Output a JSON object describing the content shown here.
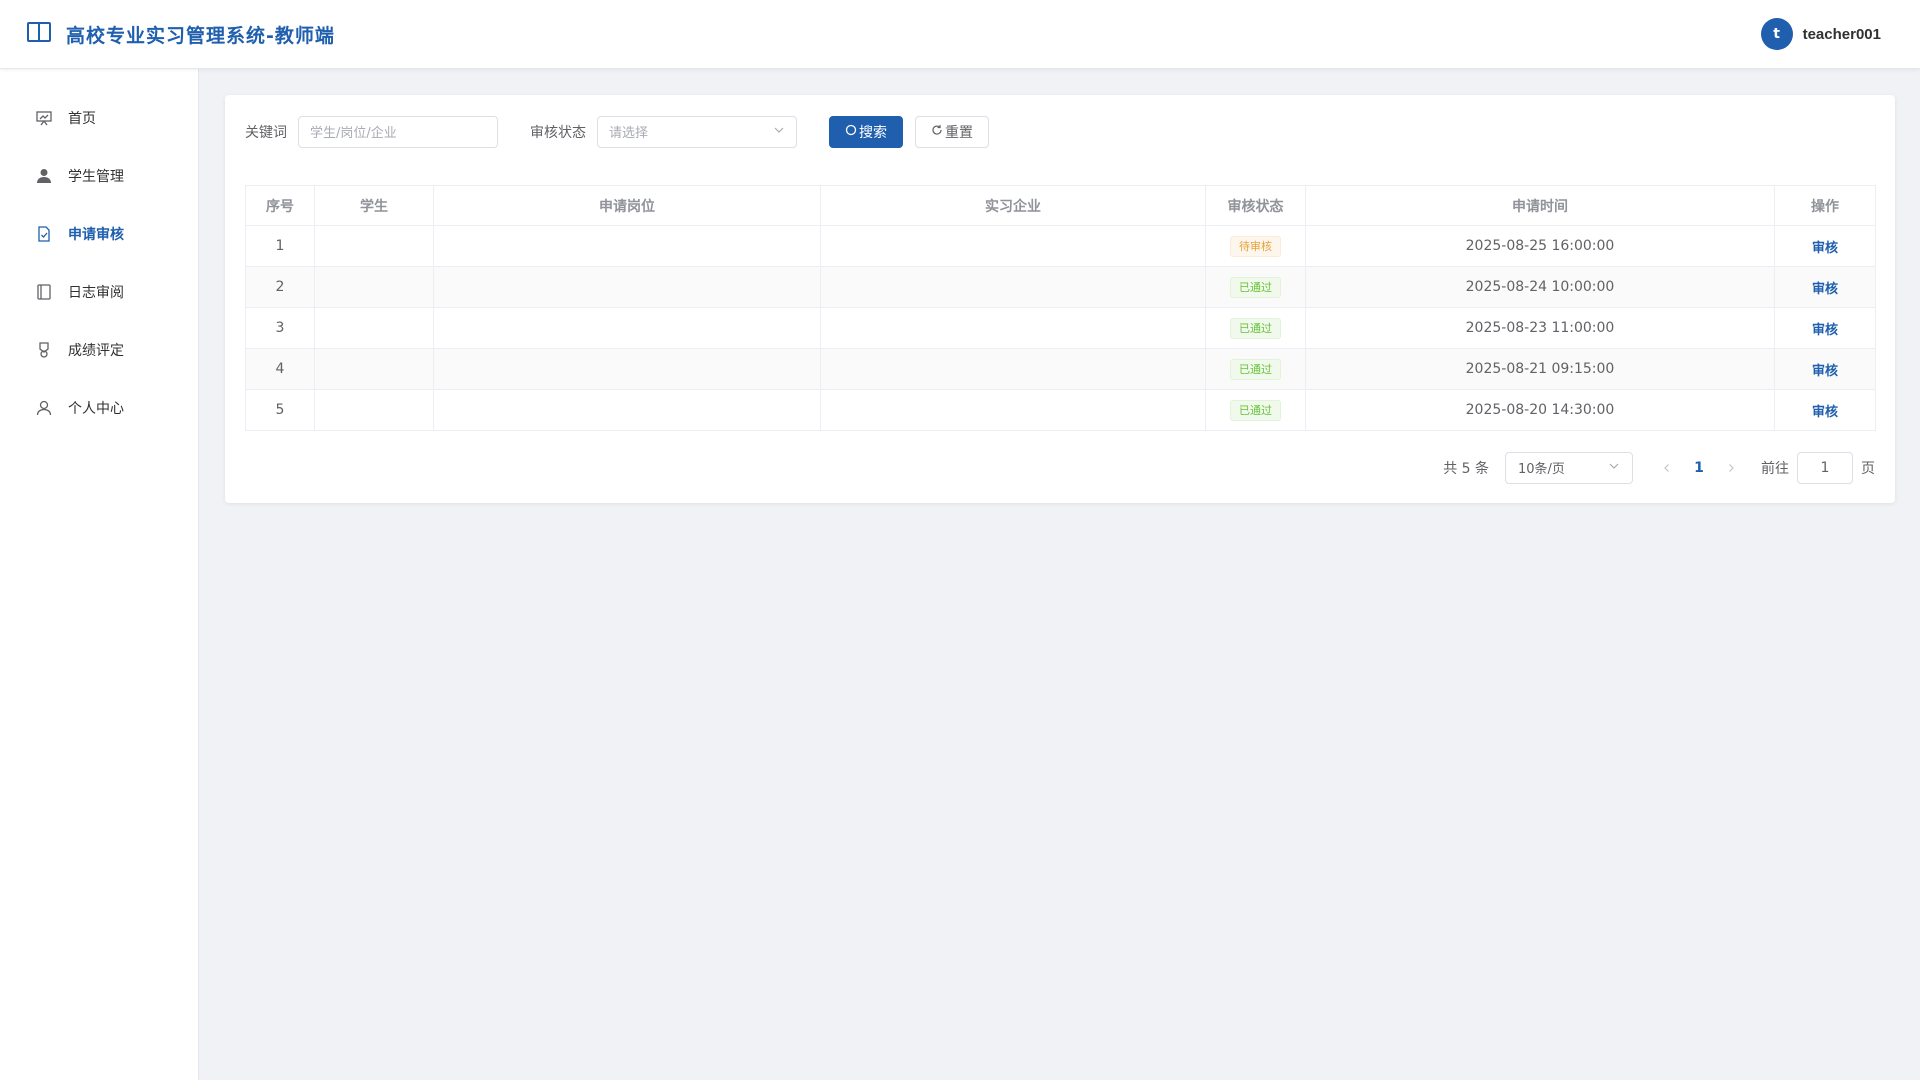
{
  "header": {
    "title": "高校专业实习管理系统-教师端",
    "icon": "book-open-icon",
    "avatar_letter": "t",
    "username": "teacher001"
  },
  "sidebar": {
    "items": [
      {
        "label": "首页",
        "icon": "presentation-board-icon",
        "active": false
      },
      {
        "label": "学生管理",
        "icon": "user-icon",
        "active": false
      },
      {
        "label": "申请审核",
        "icon": "document-check-icon",
        "active": true
      },
      {
        "label": "日志审阅",
        "icon": "notebook-icon",
        "active": false
      },
      {
        "label": "成绩评定",
        "icon": "medal-icon",
        "active": false
      },
      {
        "label": "个人中心",
        "icon": "user-outline-icon",
        "active": false
      }
    ]
  },
  "filters": {
    "keyword_label": "关键词",
    "keyword_placeholder": "学生/岗位/企业",
    "status_label": "审核状态",
    "status_placeholder": "请选择",
    "search_label": "搜索",
    "reset_label": "重置"
  },
  "table": {
    "columns": [
      "序号",
      "学生",
      "申请岗位",
      "实习企业",
      "审核状态",
      "申请时间",
      "操作"
    ],
    "rows": [
      {
        "index": "1",
        "student": "",
        "position": "",
        "company": "",
        "status": "待审核",
        "status_type": "warning",
        "time": "2025-08-25 16:00:00",
        "action": "审核"
      },
      {
        "index": "2",
        "student": "",
        "position": "",
        "company": "",
        "status": "已通过",
        "status_type": "success",
        "time": "2025-08-24 10:00:00",
        "action": "审核"
      },
      {
        "index": "3",
        "student": "",
        "position": "",
        "company": "",
        "status": "已通过",
        "status_type": "success",
        "time": "2025-08-23 11:00:00",
        "action": "审核"
      },
      {
        "index": "4",
        "student": "",
        "position": "",
        "company": "",
        "status": "已通过",
        "status_type": "success",
        "time": "2025-08-21 09:15:00",
        "action": "审核"
      },
      {
        "index": "5",
        "student": "",
        "position": "",
        "company": "",
        "status": "已通过",
        "status_type": "success",
        "time": "2025-08-20 14:30:00",
        "action": "审核"
      }
    ]
  },
  "pagination": {
    "total_text": "共 5 条",
    "page_size": "10条/页",
    "current_page": "1",
    "goto_label": "前往",
    "goto_value": "1",
    "page_suffix": "页"
  },
  "colors": {
    "primary": "#1f5fae",
    "warning": "#e6a23c",
    "success": "#67c23a"
  }
}
